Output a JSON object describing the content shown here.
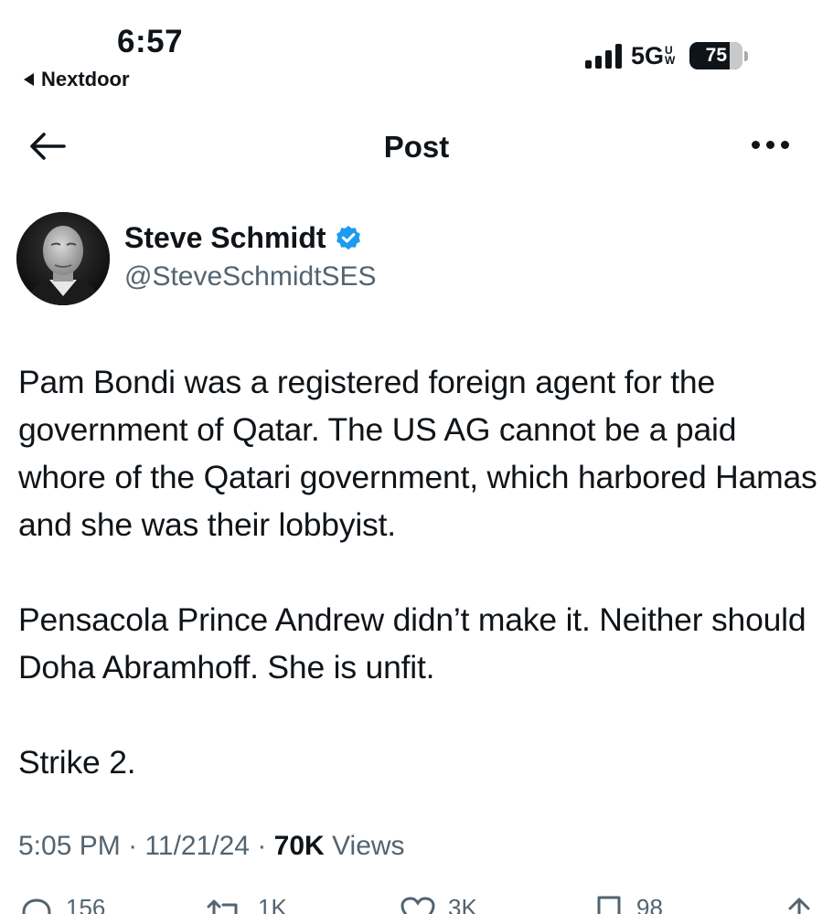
{
  "status_bar": {
    "time": "6:57",
    "back_app": "Nextdoor",
    "network": "5G",
    "network_suffix_top": "U",
    "network_suffix_bottom": "W",
    "battery": "75",
    "battery_level_percent": 75
  },
  "header": {
    "title": "Post"
  },
  "author": {
    "name": "Steve Schmidt",
    "handle": "@SteveSchmidtSES",
    "verified": true
  },
  "post": {
    "paragraphs": [
      "Pam Bondi was a registered foreign agent for the government of Qatar. The US AG cannot be a paid whore of the Qatari government, which harbored Hamas and she was their lobbyist.",
      "Pensacola Prince Andrew didn’t make it. Neither should Doha Abramhoff. She is unfit.",
      "Strike 2."
    ]
  },
  "meta": {
    "time": "5:05 PM",
    "separator": "·",
    "date": "11/21/24",
    "views_count": "70K",
    "views_label": "Views"
  },
  "actions": {
    "replies": "156",
    "reposts": "1K",
    "likes": "3K",
    "bookmarks": "98"
  },
  "colors": {
    "text": "#0f1419",
    "secondary": "#536471",
    "verified": "#1d9bf0"
  }
}
